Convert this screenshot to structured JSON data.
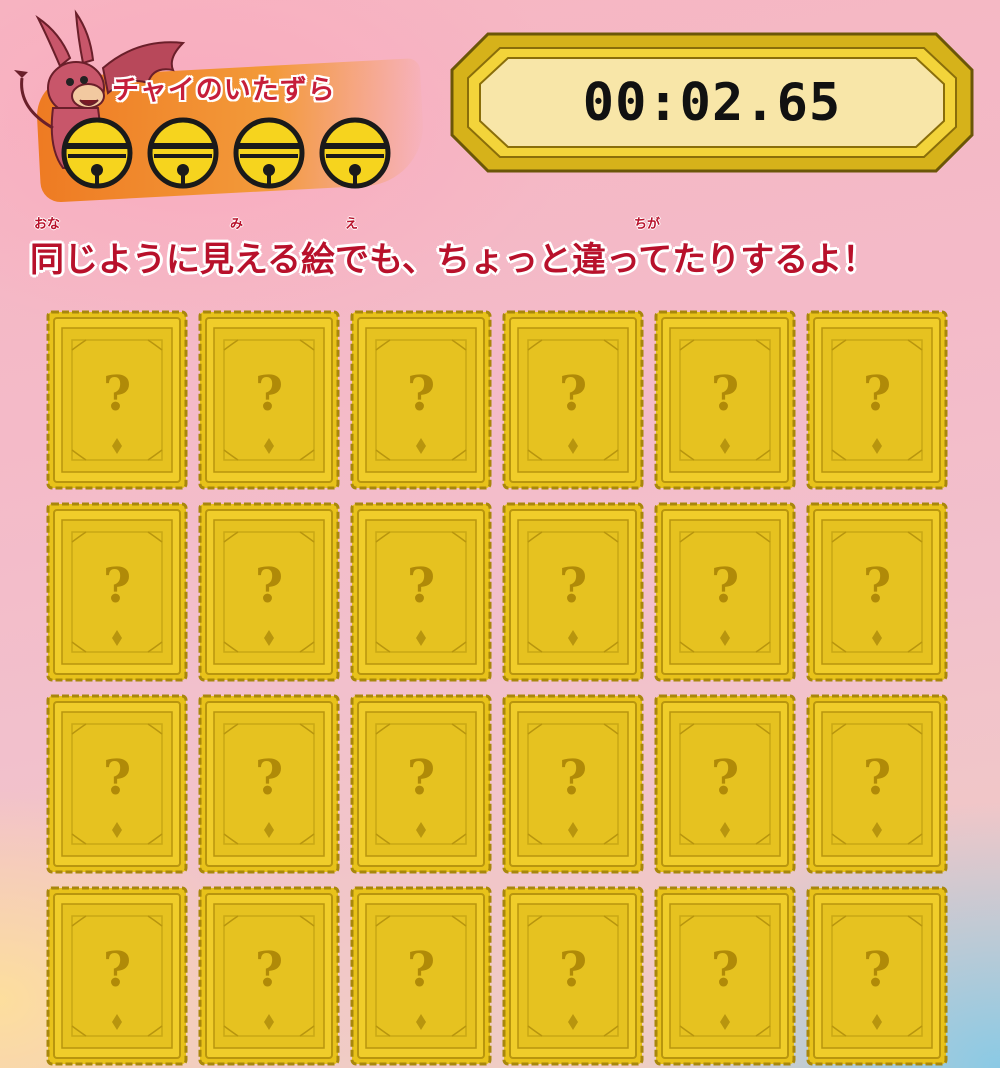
{
  "header": {
    "logo_title": "チャイのいたずら",
    "bells": [
      "bell-icon",
      "bell-icon",
      "bell-icon",
      "bell-icon"
    ]
  },
  "timer": {
    "value": "00:02.65"
  },
  "instruction": {
    "text": "同じように見える絵でも、ちょっと違ってたりするよ！",
    "ruby": [
      "おな",
      "み",
      "え",
      "ちが"
    ]
  },
  "colors": {
    "card_gold": "#e8c21a",
    "card_border": "#a8870c",
    "instruction_red": "#b8112b",
    "logo_orange": "#ee7a22",
    "timer_bg": "#f8e6a8"
  },
  "cards": [
    {
      "label": "?"
    },
    {
      "label": "?"
    },
    {
      "label": "?"
    },
    {
      "label": "?"
    },
    {
      "label": "?"
    },
    {
      "label": "?"
    },
    {
      "label": "?"
    },
    {
      "label": "?"
    },
    {
      "label": "?"
    },
    {
      "label": "?"
    },
    {
      "label": "?"
    },
    {
      "label": "?"
    },
    {
      "label": "?"
    },
    {
      "label": "?"
    },
    {
      "label": "?"
    },
    {
      "label": "?"
    },
    {
      "label": "?"
    },
    {
      "label": "?"
    },
    {
      "label": "?"
    },
    {
      "label": "?"
    },
    {
      "label": "?"
    },
    {
      "label": "?"
    },
    {
      "label": "?"
    },
    {
      "label": "?"
    }
  ]
}
